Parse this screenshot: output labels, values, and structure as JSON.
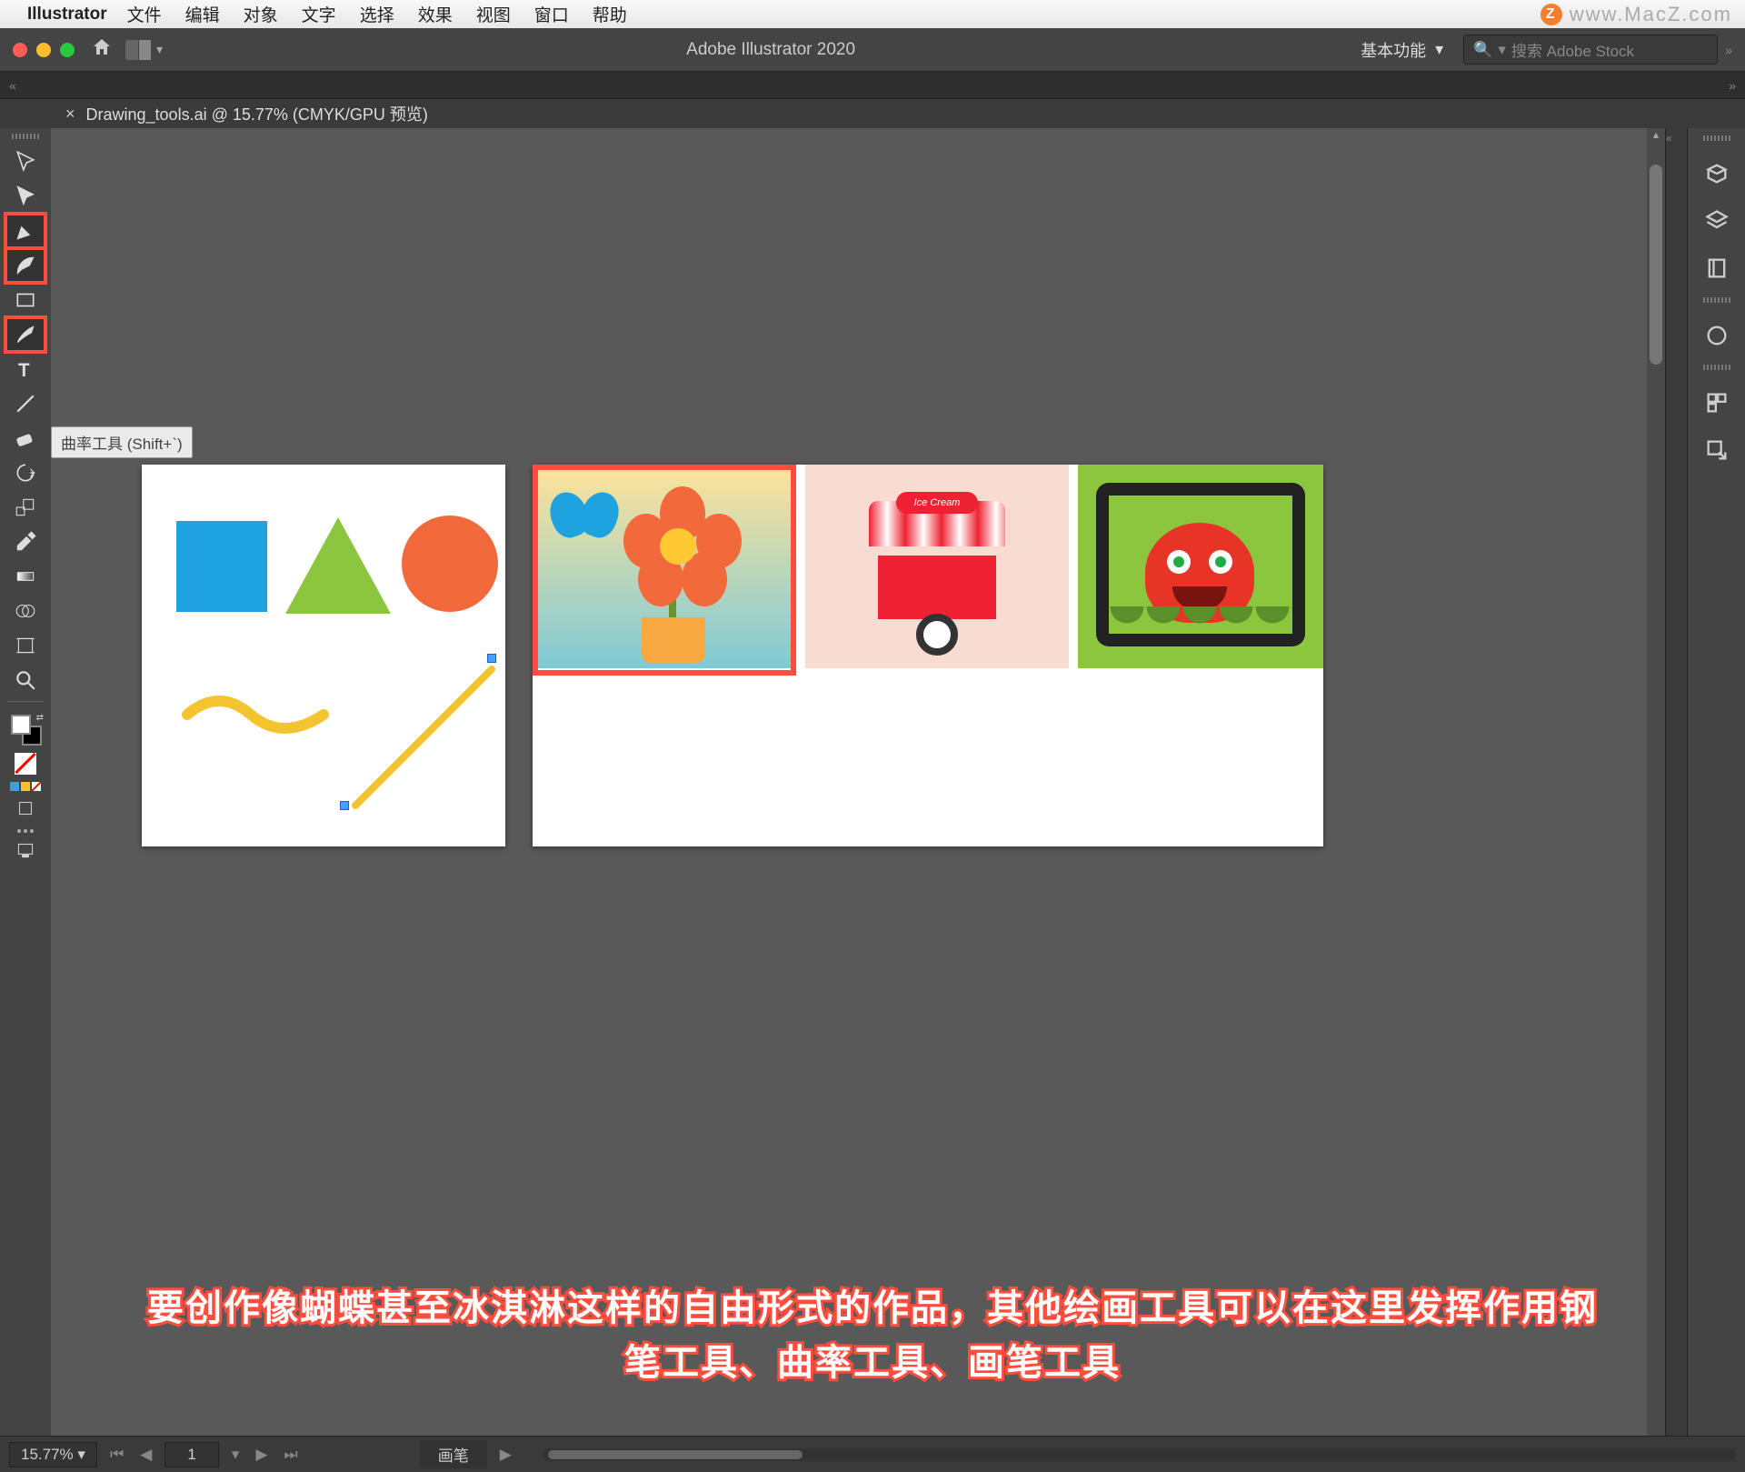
{
  "mac_menu": {
    "app_name": "Illustrator",
    "items": [
      "文件",
      "编辑",
      "对象",
      "文字",
      "选择",
      "效果",
      "视图",
      "窗口",
      "帮助"
    ]
  },
  "watermark": "www.MacZ.com",
  "watermark_badge": "Z",
  "app_topbar": {
    "title": "Adobe Illustrator 2020",
    "workspace_label": "基本功能",
    "search_placeholder": "搜索 Adobe Stock"
  },
  "document_tab": {
    "label": "Drawing_tools.ai @ 15.77% (CMYK/GPU 预览)"
  },
  "left_tools": [
    {
      "name": "selection-tool",
      "icon": "cursor"
    },
    {
      "name": "direct-selection-tool",
      "icon": "cursor-solid"
    },
    {
      "name": "pen-tool",
      "icon": "pen",
      "highlighted": true
    },
    {
      "name": "curvature-tool",
      "icon": "curvature",
      "highlighted": true
    },
    {
      "name": "rectangle-tool",
      "icon": "rect"
    },
    {
      "name": "paintbrush-tool",
      "icon": "brush",
      "highlighted": true
    },
    {
      "name": "type-tool",
      "icon": "type"
    },
    {
      "name": "line-tool",
      "icon": "line"
    },
    {
      "name": "eraser-tool",
      "icon": "eraser"
    },
    {
      "name": "rotate-tool",
      "icon": "rotate"
    },
    {
      "name": "scale-tool",
      "icon": "scale"
    },
    {
      "name": "eyedropper-tool",
      "icon": "eyedropper"
    },
    {
      "name": "gradient-tool",
      "icon": "gradient"
    },
    {
      "name": "shape-builder-tool",
      "icon": "shapebuilder"
    },
    {
      "name": "artboard-tool",
      "icon": "artboard"
    },
    {
      "name": "zoom-tool",
      "icon": "zoom"
    }
  ],
  "tooltip_text": "曲率工具 (Shift+`)",
  "right_panels": [
    {
      "name": "properties-panel",
      "icon": "3d"
    },
    {
      "name": "layers-panel",
      "icon": "layers"
    },
    {
      "name": "libraries-panel",
      "icon": "book"
    },
    {
      "name": "appearance-panel",
      "icon": "circle"
    },
    {
      "name": "artboards-panel",
      "icon": "boxes"
    },
    {
      "name": "export-panel",
      "icon": "export"
    }
  ],
  "statusbar": {
    "zoom": "15.77%",
    "artboard_num": "1",
    "panel_label": "画笔"
  },
  "thumb2_sign": "Ice Cream",
  "subtitle_line1": "要创作像蝴蝶甚至冰淇淋这样的自由形式的作品，其他绘画工具可以在这里发挥作用钢",
  "subtitle_line2": "笔工具、曲率工具、画笔工具",
  "colors": {
    "highlight": "#ff4d3d",
    "blue": "#1fa3e0",
    "green": "#8cc63f",
    "orange": "#f26a3b",
    "yellow": "#f4c430"
  }
}
